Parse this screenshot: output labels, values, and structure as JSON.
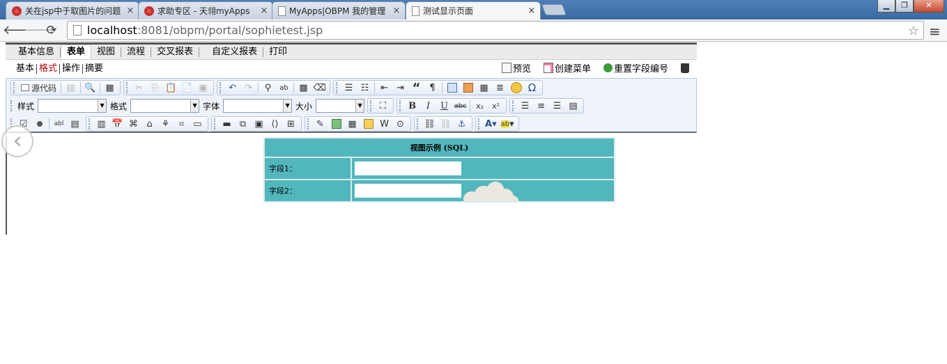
{
  "browser": {
    "tabs": [
      {
        "title": "关在jsp中于取图片的问题",
        "favicon": "app-icon"
      },
      {
        "title": "求助专区 - 天翎myApps",
        "favicon": "app-icon"
      },
      {
        "title": "MyApps|OBPM 我的管理",
        "favicon": "page-icon"
      },
      {
        "title": "测试显示页面",
        "favicon": "page-icon",
        "active": true
      }
    ],
    "url_host": "localhost",
    "url_rest": ":8081/obpm/portal/sophietest.jsp"
  },
  "main_tabs": [
    "基本信息",
    "表单",
    "视图",
    "流程",
    "交叉报表",
    "自定义报表",
    "打印"
  ],
  "main_tab_active": "表单",
  "sub_tabs": [
    "基本",
    "格式",
    "操作",
    "摘要"
  ],
  "sub_tab_active": "格式",
  "actions": {
    "preview": "预览",
    "create_menu": "创建菜单",
    "reorder_fields": "重置字段编号",
    "delete": "删除"
  },
  "editor": {
    "source_label": "源代码",
    "style_label": "样式",
    "format_label": "格式",
    "font_label": "字体",
    "size_label": "大小",
    "bold": "B",
    "italic": "I",
    "underline": "U",
    "strike": "abc",
    "subscript": "x₂",
    "superscript": "x²",
    "omega": "Ω",
    "quote": "“",
    "text_color": "A",
    "bg_color": "ab"
  },
  "view_table": {
    "caption": "视图示例 (SQL)",
    "rows": [
      {
        "label": "字段1：",
        "value": ""
      },
      {
        "label": "字段2：",
        "value": ""
      }
    ]
  },
  "colors": {
    "table_bg": "#52b7bd",
    "active_subtab": "#bb0000",
    "tabstrip": "#4f7fb6"
  }
}
